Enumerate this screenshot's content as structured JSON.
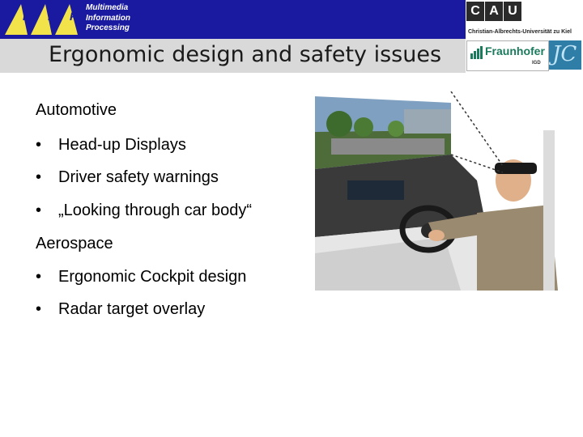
{
  "header": {
    "title": "Ergonomic design and safety issues",
    "mip_letters": [
      "M",
      "I",
      "P"
    ],
    "mip_lines": [
      "Multimedia",
      "Information",
      "Processing"
    ],
    "cau_letters": [
      "C",
      "A",
      "U"
    ],
    "cau_subtitle": "Christian-Albrechts-Universität zu Kiel",
    "fraunhofer_name": "Fraunhofer",
    "fraunhofer_unit": "IGD",
    "jc_label": "JC"
  },
  "content": {
    "sections": [
      {
        "heading": "Automotive",
        "bullets": [
          "Head-up Displays",
          "Driver safety warnings",
          "„Looking through car body“"
        ]
      },
      {
        "heading": "Aerospace",
        "bullets": [
          "Ergonomic Cockpit design",
          "Radar target overlay"
        ]
      }
    ],
    "bullet_symbol": "•"
  },
  "colors": {
    "header_band": "#1a1aa0",
    "title_band": "#d9d9d9",
    "mip_yellow": "#f2e34a",
    "fraunhofer_green": "#1a7a5c"
  },
  "image": {
    "description_icon": "car-simulator-photo"
  }
}
